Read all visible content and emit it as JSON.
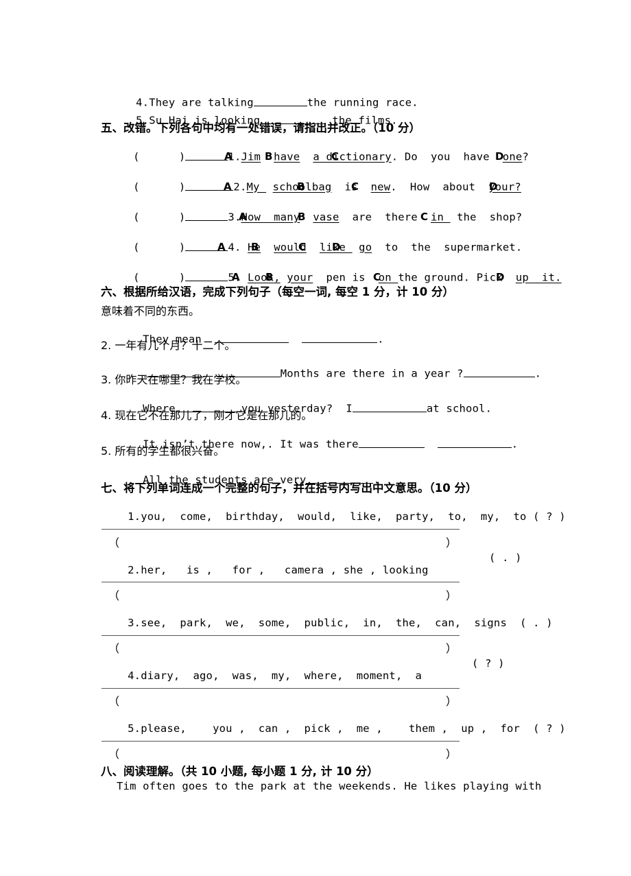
{
  "document": {
    "type": "english-exam-paper",
    "language": "zh-CN+en"
  },
  "top_items": [
    {
      "num": "4.",
      "pre": "They are talking",
      "blank": true,
      "post": "the running race."
    },
    {
      "num": "5.",
      "pre": "Su Hai is looking ",
      "blank": true,
      "post": " the films."
    }
  ],
  "section_five": {
    "heading": "五、改错。下列各句中均有一处错误，请指出并改正。（10 分）",
    "items": [
      {
        "num": "1.",
        "segments": "Jim  have  a dictionary. Do  you  have  one?",
        "options": [
          "A",
          "B",
          "C",
          "D"
        ]
      },
      {
        "num": "2.",
        "segments": "My  schoolbag  is  new.  How  about  your?",
        "options": [
          "A",
          "B",
          "C",
          "D"
        ]
      },
      {
        "num": "3.",
        "segments": "How  many  vase  are  there  in  the  shop?",
        "options": [
          "A",
          "B",
          "C"
        ]
      },
      {
        "num": "4.",
        "segments": "He  would  like  go  to  the  supermarket.",
        "options": [
          "A",
          "B",
          "C",
          "D"
        ]
      },
      {
        "num": "5.",
        "segments": "Look, your  pen is  on the ground. Pick  up  it.",
        "options": [
          "A",
          "B",
          "C",
          "D"
        ]
      }
    ]
  },
  "section_six": {
    "heading": "六、根据所给汉语，完成下列句子（每空一词, 每空 1 分，计 10 分）",
    "items": [
      {
        "cn": "意味着不同的东西。",
        "en_pre": "They mean  ",
        "en_mid": "  ",
        "en_post": "."
      },
      {
        "cn": "2. 一年有几个月？十二个。",
        "en_pre": " ",
        "en_mid": "Months are there in a year ?",
        "en_post": "."
      },
      {
        "cn": "3. 你昨天在哪里？我在学校。",
        "en_pre": "Where",
        "en_mid": "you yesterday?  I",
        "en_post": "at school."
      },
      {
        "cn": "4. 现在它不在那儿了，刚才它是在那儿的。",
        "en_pre": "It isn’t there now,. It was there",
        "en_mid": "  ",
        "en_post": "."
      },
      {
        "cn": "5. 所有的学生都很兴奋。",
        "en_pre": "All the students are very",
        "en_mid": "",
        "en_post": "."
      }
    ]
  },
  "section_seven": {
    "heading": "七、将下列单词连成一个完整的句子，并在括号内写出中文意思。（10 分）",
    "items": [
      {
        "num": "1.",
        "words": "you,  come,  birthday,  would,  like,  party,  to,  my,  to",
        "mark": "( ? )"
      },
      {
        "num": "2.",
        "words": "her,   is ,   for ,   camera , she , looking",
        "mark": "( . )"
      },
      {
        "num": "3.",
        "words": "see,  park,  we,  some,  public,  in,  the,  can,  signs",
        "mark": "( . )"
      },
      {
        "num": "4.",
        "words": "diary,  ago,  was,  my,  where,  moment,  a",
        "mark": "( ? )"
      },
      {
        "num": "5.",
        "words": "please,    you ,  can ,  pick ,  me ,    them ,  up ,  for",
        "mark": "( ? )"
      }
    ],
    "paren_open": "（",
    "paren_close": "）"
  },
  "section_eight": {
    "heading": "八、阅读理解。（共 10 小题, 每小题 1 分, 计 10 分）",
    "passage_line": "Tim often goes to the park at the weekends. He likes playing with"
  }
}
